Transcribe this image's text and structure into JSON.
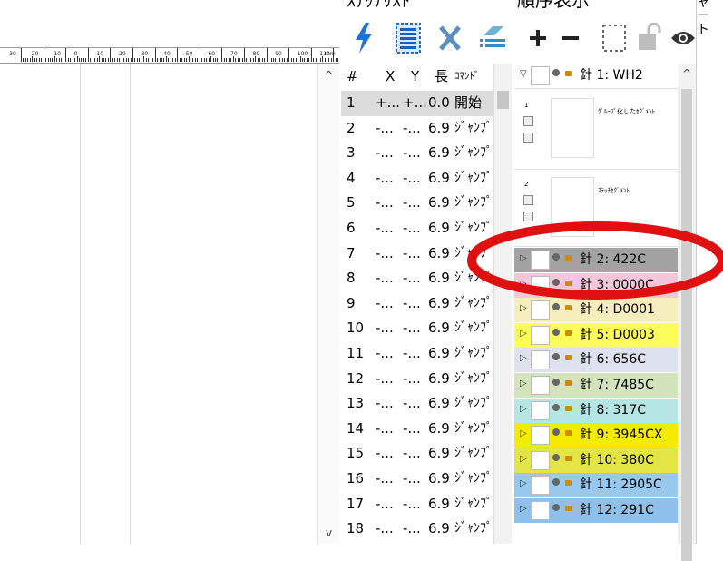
{
  "stitch_panel": {
    "title": "ｽﾃｯﾁﾘｽﾄ"
  },
  "order_panel": {
    "title": "順序表示"
  },
  "side_tab": {
    "label": "ャート"
  },
  "ruler": {
    "unit": "mm",
    "labels": [
      "-30",
      "-20",
      "-10",
      "0",
      "10",
      "20",
      "30",
      "40",
      "50",
      "60",
      "70",
      "80",
      "90",
      "100",
      "110"
    ]
  },
  "toolbar": {
    "icons": [
      "lightning-icon",
      "list-icon",
      "delete-x-icon",
      "reorder-icon",
      "plus-icon",
      "minus-icon",
      "select-rect-icon",
      "lock-icon",
      "eye-icon"
    ]
  },
  "stitch_list": {
    "headers": {
      "num": "#",
      "x": "X",
      "y": "Y",
      "len": "長",
      "cmd": "ｺﾏﾝﾄﾞ"
    },
    "rows": [
      {
        "num": "1",
        "x": "+...",
        "y": "+...",
        "len": "0.0",
        "cmd": "開始"
      },
      {
        "num": "2",
        "x": "-...",
        "y": "-...",
        "len": "6.9",
        "cmd": "ｼﾞｬﾝﾌﾟ"
      },
      {
        "num": "3",
        "x": "-...",
        "y": "-...",
        "len": "6.9",
        "cmd": "ｼﾞｬﾝﾌﾟ"
      },
      {
        "num": "4",
        "x": "-...",
        "y": "-...",
        "len": "6.9",
        "cmd": "ｼﾞｬﾝﾌﾟ"
      },
      {
        "num": "5",
        "x": "-...",
        "y": "-...",
        "len": "6.9",
        "cmd": "ｼﾞｬﾝﾌﾟ"
      },
      {
        "num": "6",
        "x": "-...",
        "y": "-...",
        "len": "6.9",
        "cmd": "ｼﾞｬﾝﾌﾟ"
      },
      {
        "num": "7",
        "x": "-...",
        "y": "-...",
        "len": "6.9",
        "cmd": "ｼﾞｬﾝﾌﾟ"
      },
      {
        "num": "8",
        "x": "-...",
        "y": "-...",
        "len": "6.9",
        "cmd": "ｼﾞｬﾝﾌﾟ"
      },
      {
        "num": "9",
        "x": "-...",
        "y": "-...",
        "len": "6.9",
        "cmd": "ｼﾞｬﾝﾌﾟ"
      },
      {
        "num": "10",
        "x": "-...",
        "y": "-...",
        "len": "6.9",
        "cmd": "ｼﾞｬﾝﾌﾟ"
      },
      {
        "num": "11",
        "x": "-...",
        "y": "-...",
        "len": "6.9",
        "cmd": "ｼﾞｬﾝﾌﾟ"
      },
      {
        "num": "12",
        "x": "-...",
        "y": "-...",
        "len": "6.9",
        "cmd": "ｼﾞｬﾝﾌﾟ"
      },
      {
        "num": "13",
        "x": "-...",
        "y": "-...",
        "len": "6.9",
        "cmd": "ｼﾞｬﾝﾌﾟ"
      },
      {
        "num": "14",
        "x": "-...",
        "y": "-...",
        "len": "6.9",
        "cmd": "ｼﾞｬﾝﾌﾟ"
      },
      {
        "num": "15",
        "x": "-...",
        "y": "-...",
        "len": "6.9",
        "cmd": "ｼﾞｬﾝﾌﾟ"
      },
      {
        "num": "16",
        "x": "-...",
        "y": "-...",
        "len": "6.9",
        "cmd": "ｼﾞｬﾝﾌﾟ"
      },
      {
        "num": "17",
        "x": "-...",
        "y": "-...",
        "len": "6.9",
        "cmd": "ｼﾞｬﾝﾌﾟ"
      },
      {
        "num": "18",
        "x": "-...",
        "y": "-...",
        "len": "6.9",
        "cmd": "ｼﾞｬﾝﾌﾟ"
      }
    ]
  },
  "needles": {
    "first": {
      "label": "針 1: WH2"
    },
    "groups": [
      {
        "num": "1",
        "name": "ｸﾞﾙｰﾌﾟ化したｾｸﾞﾒﾝﾄ"
      },
      {
        "num": "2",
        "name": "ｽﾃｯﾁｾｸﾞﾒﾝﾄ"
      }
    ],
    "items": [
      {
        "label": "針 2: 422C",
        "color": "#a3a3a3"
      },
      {
        "label": "針 3: 0000C",
        "color": "#f2c8d8"
      },
      {
        "label": "針 4: D0001",
        "color": "#f6eebc"
      },
      {
        "label": "針 5: D0003",
        "color": "#fdfd5a"
      },
      {
        "label": "針 6: 656C",
        "color": "#dde2ee"
      },
      {
        "label": "針 7: 7485C",
        "color": "#d3e3bb"
      },
      {
        "label": "針 8: 317C",
        "color": "#b6e6e4"
      },
      {
        "label": "針 9: 3945CX",
        "color": "#f4eb00"
      },
      {
        "label": "針 10: 380C",
        "color": "#e3e544"
      },
      {
        "label": "針 11: 2905C",
        "color": "#99c8ee"
      },
      {
        "label": "針 12: 291C",
        "color": "#8ec0ec"
      }
    ]
  },
  "highlight": {
    "color": "#e01010"
  }
}
